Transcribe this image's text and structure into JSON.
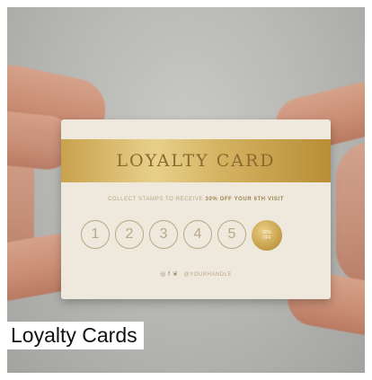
{
  "caption": "Loyalty Cards",
  "card": {
    "title": "LOYALTY CARD",
    "instruction_prefix": "COLLECT STAMPS TO RECEIVE",
    "instruction_reward": "30% OFF YOUR 6TH VISIT",
    "stamps": [
      "1",
      "2",
      "3",
      "4",
      "5"
    ],
    "reward_line1": "30%",
    "reward_line2": "OFF",
    "social_icons": "◎ f ❦",
    "social_handle": "@YOURHANDLE"
  },
  "colors": {
    "gold": "#c9a24e",
    "card_background": "#eee8dd",
    "caption_background": "#ffffff",
    "caption_text": "#111111"
  }
}
